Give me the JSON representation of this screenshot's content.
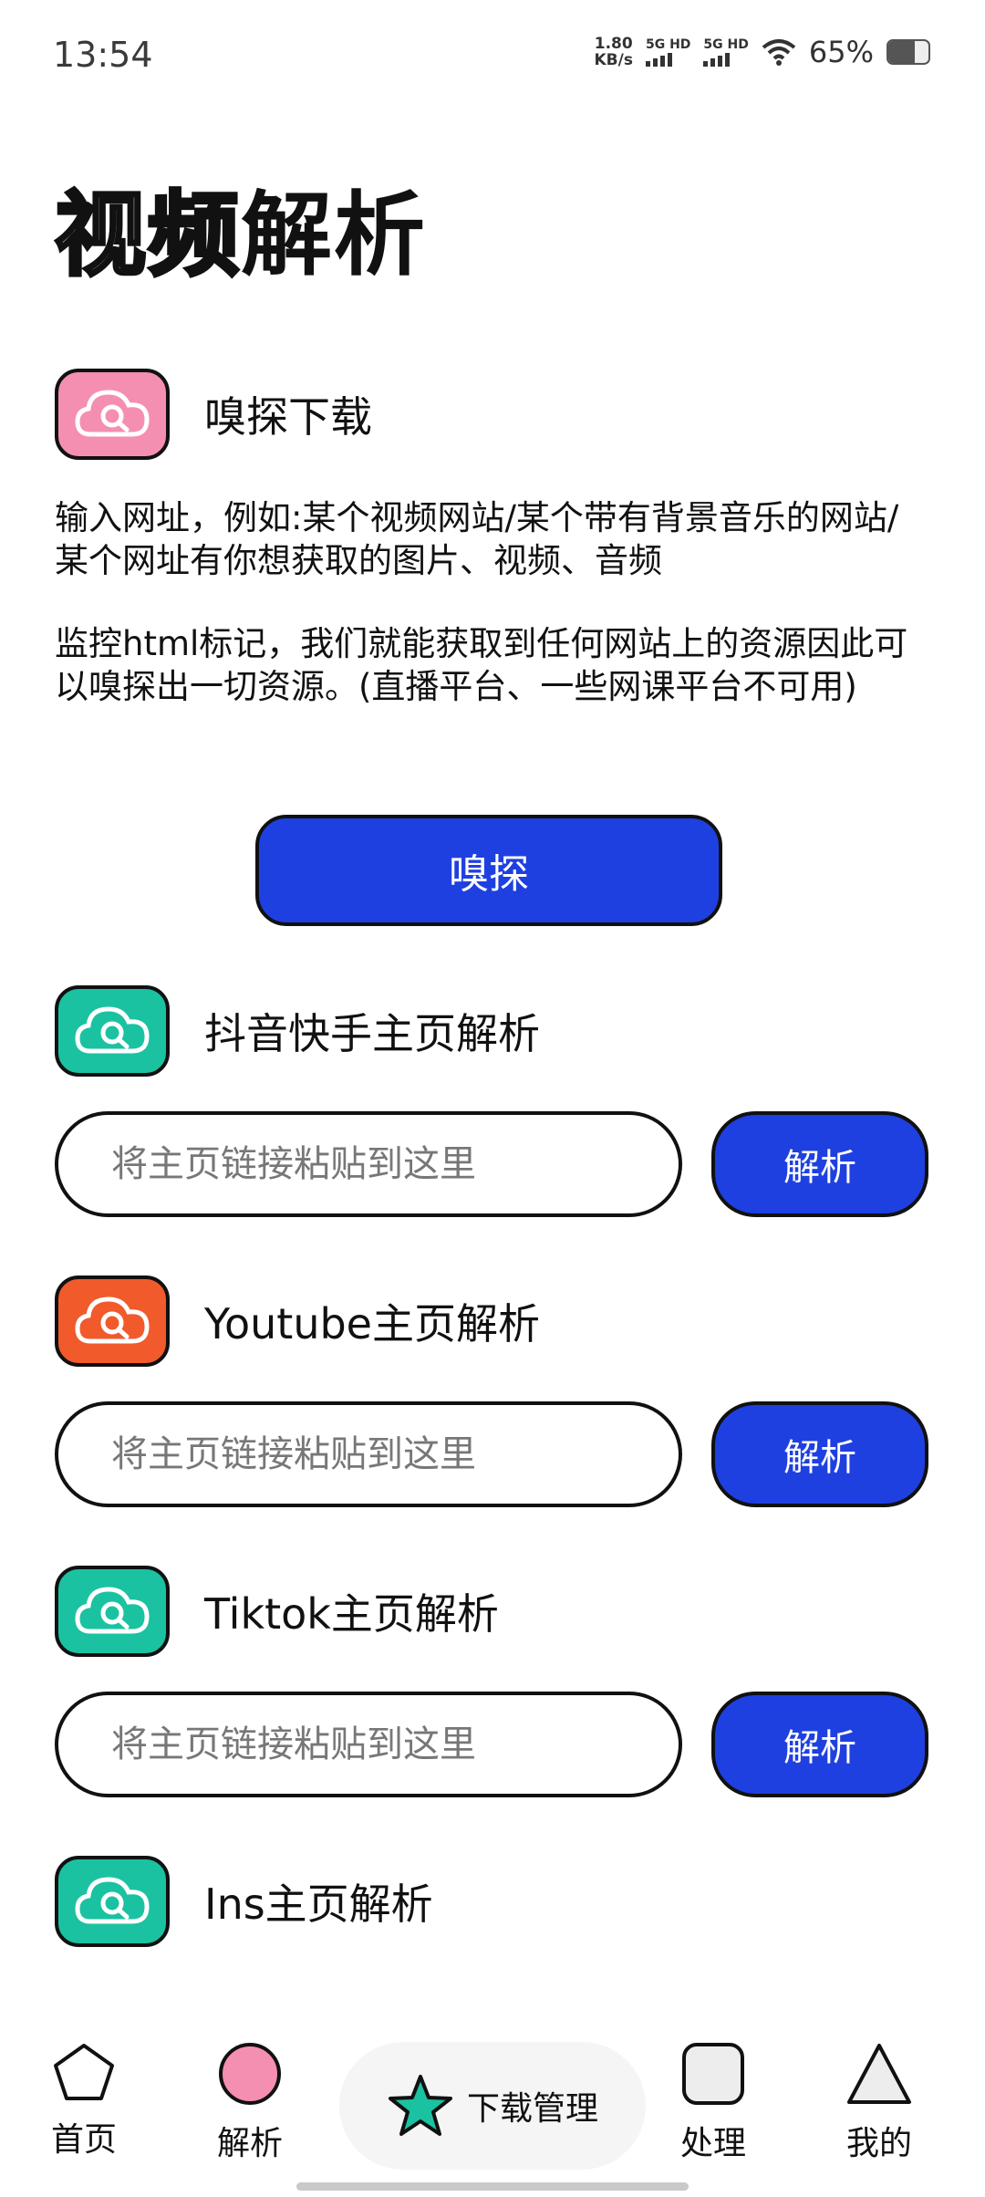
{
  "status_bar": {
    "time": "13:54",
    "net_speed_value": "1.80",
    "net_speed_unit": "KB/s",
    "sim1_label": "5G HD",
    "sim2_label": "5G HD",
    "battery_percent": "65%",
    "battery_level": 0.65
  },
  "title": {
    "outline_part": "视频",
    "solid_part": "解析"
  },
  "sniff": {
    "title": "嗅探下载",
    "icon": "cloud-search-icon",
    "icon_color": "#f48fb1",
    "desc_1": "输入网址，例如:某个视频网站/某个带有背景音乐的网站/某个网址有你想获取的图片、视频、音频",
    "desc_2": "监控html标记，我们就能获取到任何网站上的资源因此可以嗅探出一切资源。(直播平台、一些网课平台不可用)",
    "button_label": "嗅探"
  },
  "parsers": [
    {
      "title": "抖音快手主页解析",
      "icon": "cloud-search-icon",
      "icon_color": "#1ac2a2",
      "placeholder": "将主页链接粘贴到这里",
      "button": "解析"
    },
    {
      "title": "Youtube主页解析",
      "icon": "cloud-search-icon",
      "icon_color": "#f15a2b",
      "placeholder": "将主页链接粘贴到这里",
      "button": "解析"
    },
    {
      "title": "Tiktok主页解析",
      "icon": "cloud-search-icon",
      "icon_color": "#1ac2a2",
      "placeholder": "将主页链接粘贴到这里",
      "button": "解析"
    },
    {
      "title": "Ins主页解析",
      "icon": "cloud-search-icon",
      "icon_color": "#1ac2a2"
    }
  ],
  "colors": {
    "accent_blue": "#1f40e0",
    "pink": "#f48fb1",
    "teal": "#1ac2a2",
    "orange": "#f15a2b"
  },
  "nav": {
    "home": {
      "label": "首页",
      "icon": "pentagon-icon"
    },
    "parse": {
      "label": "解析",
      "icon": "pink-circle-icon"
    },
    "downloads": {
      "label": "下载管理",
      "icon": "star-icon"
    },
    "process": {
      "label": "处理",
      "icon": "rounded-square-icon"
    },
    "me": {
      "label": "我的",
      "icon": "triangle-icon"
    }
  }
}
